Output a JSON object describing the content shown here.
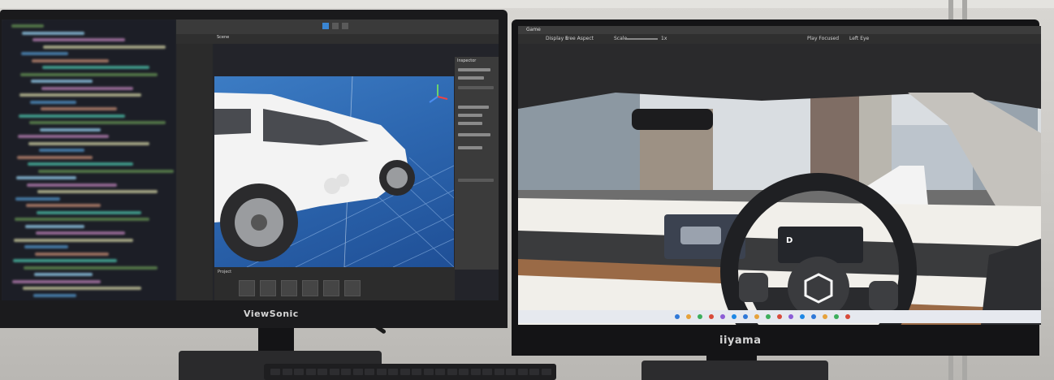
{
  "monitor_left": {
    "brand": "ViewSonic",
    "unity": {
      "panels": {
        "hierarchy": "Scene",
        "inspector": "Inspector",
        "project": "Project"
      }
    }
  },
  "monitor_right": {
    "brand": "iiyama",
    "game_view": {
      "tab": "Game",
      "display": "Display 1",
      "aspect": "Free Aspect",
      "scale_label": "Scale",
      "scale_value": "1x",
      "play_mode": "Play Focused",
      "eye": "Left Eye",
      "gear_indicator": "D"
    }
  },
  "colors": {
    "unity_blue_sky": "#2d67b0",
    "unity_panel": "#3b3b3b",
    "car_white": "#f3f3f3"
  }
}
